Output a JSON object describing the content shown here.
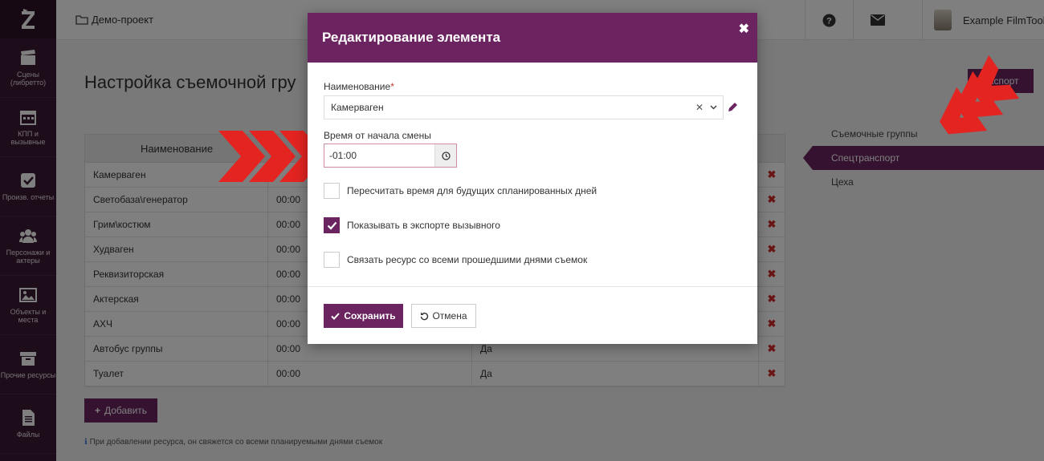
{
  "app": {
    "project_name": "Демо-проект",
    "user_name": "Example FilmToolz"
  },
  "sidebar": {
    "items": [
      {
        "label": "Сцены (либретто)",
        "icon": "clapperboard-icon"
      },
      {
        "label": "КПП и вызывные",
        "icon": "calendar-icon"
      },
      {
        "label": "Произв. отчеты",
        "icon": "check-square-icon"
      },
      {
        "label": "Персонажи и актеры",
        "icon": "users-icon"
      },
      {
        "label": "Объекты и места",
        "icon": "image-icon"
      },
      {
        "label": "Прочие ресурсы",
        "icon": "archive-icon"
      },
      {
        "label": "Файлы",
        "icon": "file-icon"
      }
    ]
  },
  "page": {
    "title": "Настройка съемочной гру",
    "export_label": "Экспорт",
    "add_label": "Добавить",
    "hint": "При добавлении ресурса, он свяжется со всеми планируемыми днями съемок",
    "table": {
      "headers": [
        "Наименование"
      ],
      "rows": [
        {
          "name": "Камерваген",
          "time": "",
          "export": ""
        },
        {
          "name": "Светобаза\\генератор",
          "time": "00:00",
          "export": ""
        },
        {
          "name": "Грим\\костюм",
          "time": "00:00",
          "export": ""
        },
        {
          "name": "Худваген",
          "time": "00:00",
          "export": ""
        },
        {
          "name": "Реквизиторская",
          "time": "00:00",
          "export": ""
        },
        {
          "name": "Актерская",
          "time": "00:00",
          "export": ""
        },
        {
          "name": "АХЧ",
          "time": "00:00",
          "export": ""
        },
        {
          "name": "Автобус группы",
          "time": "00:00",
          "export": "Да"
        },
        {
          "name": "Туалет",
          "time": "00:00",
          "export": "Да"
        }
      ]
    }
  },
  "right_nav": {
    "items": [
      {
        "label": "Съемочные группы",
        "active": false
      },
      {
        "label": "Спецтранспорт",
        "active": true
      },
      {
        "label": "Цеха",
        "active": false
      }
    ]
  },
  "modal": {
    "title": "Редактирование элемента",
    "name_label": "Наименование",
    "name_required_mark": "*",
    "name_value": "Камерваген",
    "time_label": "Время от начала смены",
    "time_value": "-01:00",
    "checkboxes": [
      {
        "label": "Пересчитать время для будущих спланированных дней",
        "checked": false
      },
      {
        "label": "Показывать в экспорте вызывного",
        "checked": true
      },
      {
        "label": "Связать ресурс со всеми прошедшими днями съемок",
        "checked": false
      }
    ],
    "save_label": "Сохранить",
    "cancel_label": "Отмена"
  },
  "colors": {
    "brand": "#6b2460",
    "sidebar": "#3b1a37",
    "arrow": "#e32421",
    "delete": "#d42a2a"
  }
}
